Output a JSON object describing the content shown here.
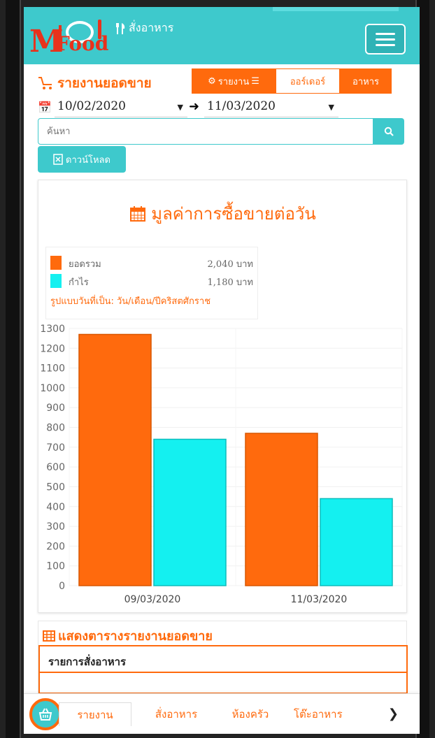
{
  "header": {
    "logo_m": "M",
    "logo_food": "Food",
    "brand_label": "สั่งอาหาร",
    "menu_icon": "hamburger-icon",
    "accent_color": "#3ec9cc"
  },
  "toolbar": {
    "title": "รายงานยอดขาย",
    "report_label": "รายงาน",
    "order_label": "ออร์เดอร์",
    "food_label": "อาหาร",
    "brand_orange": "#ff6a0d"
  },
  "date_range": {
    "from": "10/02/2020",
    "to": "11/03/2020"
  },
  "search": {
    "placeholder": "ค้นหา"
  },
  "download": {
    "label": "ดาวน์โหลด"
  },
  "chart_card": {
    "title": "มูลค่าการซื้อขายต่อวัน",
    "legend": [
      {
        "name": "ยอดรวม",
        "value": "2,040 บาท",
        "color": "#ff6a0d"
      },
      {
        "name": "กำไร",
        "value": "1,180 บาท",
        "color": "#14f0f0"
      }
    ],
    "date_note": "รูปแบบวันที่เป็น: วัน/เดือน/ปีคริสตศักราช"
  },
  "chart_data": {
    "type": "bar",
    "categories": [
      "09/03/2020",
      "11/03/2020"
    ],
    "series": [
      {
        "name": "ยอดรวม",
        "values": [
          1270,
          770
        ],
        "color": "#ff6a0d"
      },
      {
        "name": "กำไร",
        "values": [
          740,
          440
        ],
        "color": "#14f0f0"
      }
    ],
    "ylim": [
      0,
      1300
    ],
    "yticks": [
      0,
      100,
      200,
      300,
      400,
      500,
      600,
      700,
      800,
      900,
      1000,
      1100,
      1200,
      1300
    ],
    "grid": true
  },
  "table_card": {
    "title": "แสดงตารางรายงานยอดขาย",
    "header": "รายการสั่งอาหาร"
  },
  "bottom_nav": {
    "items": [
      "รายงาน",
      "สั่งอาหาร",
      "ห้องครัว",
      "โต๊ะอาหาร"
    ],
    "more_icon": "chevron-right-icon"
  }
}
